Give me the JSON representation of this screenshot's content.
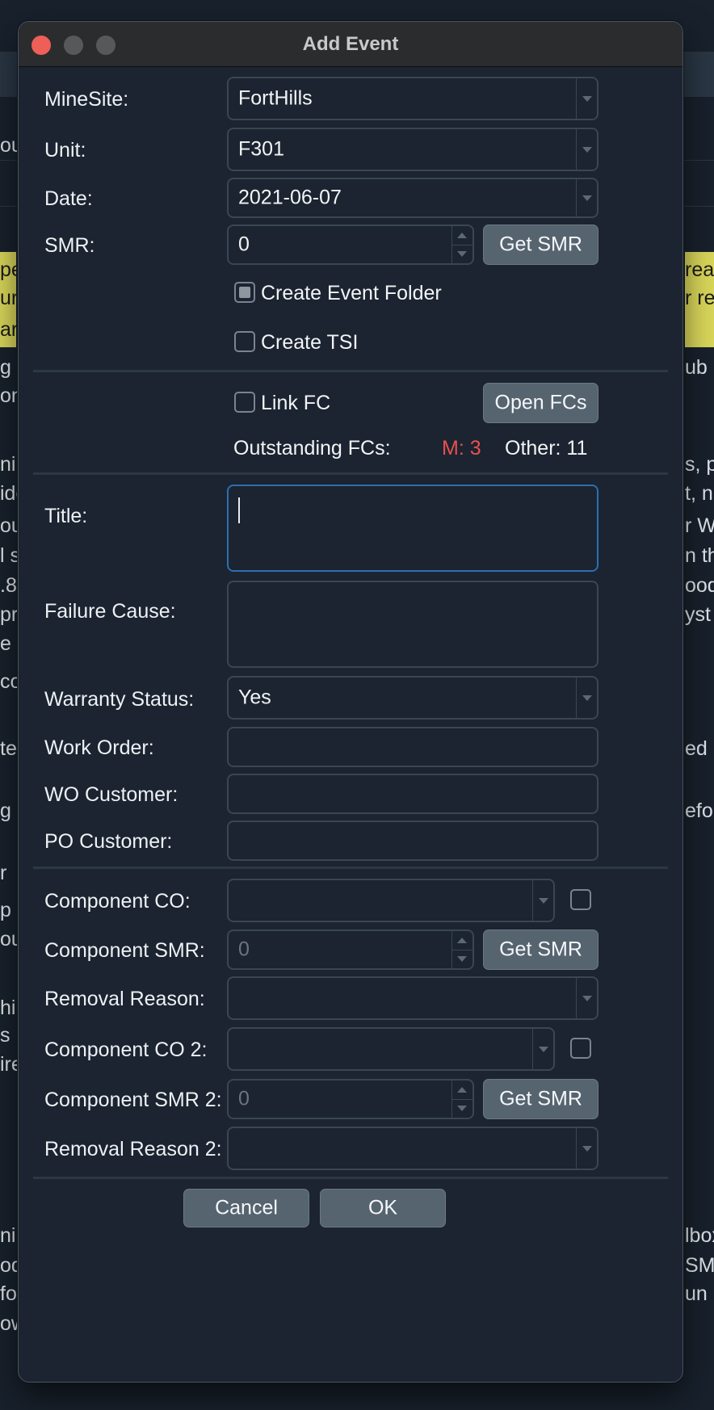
{
  "background": {
    "left_fragments": [
      "ou",
      "pe",
      "uri",
      "arr",
      "g f",
      "on",
      "ni",
      "ide",
      "ou",
      "l s",
      ".8",
      "pr",
      "e r",
      "co",
      "te,",
      "g",
      "r",
      "p",
      "ou",
      "hi",
      "s",
      "ire",
      "ni",
      "od",
      "fo",
      "ow"
    ],
    "right_fragments": [
      "rea",
      "r re",
      "ub h",
      "s, p",
      "t, n",
      "r W",
      "n th",
      "ood",
      "yst",
      "ed",
      "efo",
      "lbox",
      "SMS",
      "un"
    ]
  },
  "dialog": {
    "title": "Add Event",
    "minesite": {
      "label": "MineSite:",
      "value": "FortHills"
    },
    "unit": {
      "label": "Unit:",
      "value": "F301"
    },
    "date": {
      "label": "Date:",
      "value": "2021-06-07"
    },
    "smr": {
      "label": "SMR:",
      "value": "0",
      "button": "Get SMR"
    },
    "create_event_folder": {
      "label": "Create Event Folder",
      "state": "partial"
    },
    "create_tsi": {
      "label": "Create TSI",
      "checked": false
    },
    "link_fc": {
      "label": "Link FC",
      "checked": false,
      "button": "Open FCs"
    },
    "outstanding": {
      "label": "Outstanding FCs:",
      "m": "M: 3",
      "other": "Other: 11",
      "m_color": "#e8504f"
    },
    "title_field": {
      "label": "Title:",
      "value": ""
    },
    "failure_cause": {
      "label": "Failure Cause:",
      "value": ""
    },
    "warranty_status": {
      "label": "Warranty Status:",
      "value": "Yes"
    },
    "work_order": {
      "label": "Work Order:",
      "value": ""
    },
    "wo_customer": {
      "label": "WO Customer:",
      "value": ""
    },
    "po_customer": {
      "label": "PO Customer:",
      "value": ""
    },
    "component_co": {
      "label": "Component CO:",
      "value": ""
    },
    "component_smr": {
      "label": "Component SMR:",
      "value": "0",
      "button": "Get SMR"
    },
    "removal_reason": {
      "label": "Removal Reason:",
      "value": ""
    },
    "component_co2": {
      "label": "Component CO 2:",
      "value": ""
    },
    "component_smr2": {
      "label": "Component SMR 2:",
      "value": "0",
      "button": "Get SMR"
    },
    "removal_reason2": {
      "label": "Removal Reason 2:",
      "value": ""
    },
    "cancel": "Cancel",
    "ok": "OK"
  }
}
